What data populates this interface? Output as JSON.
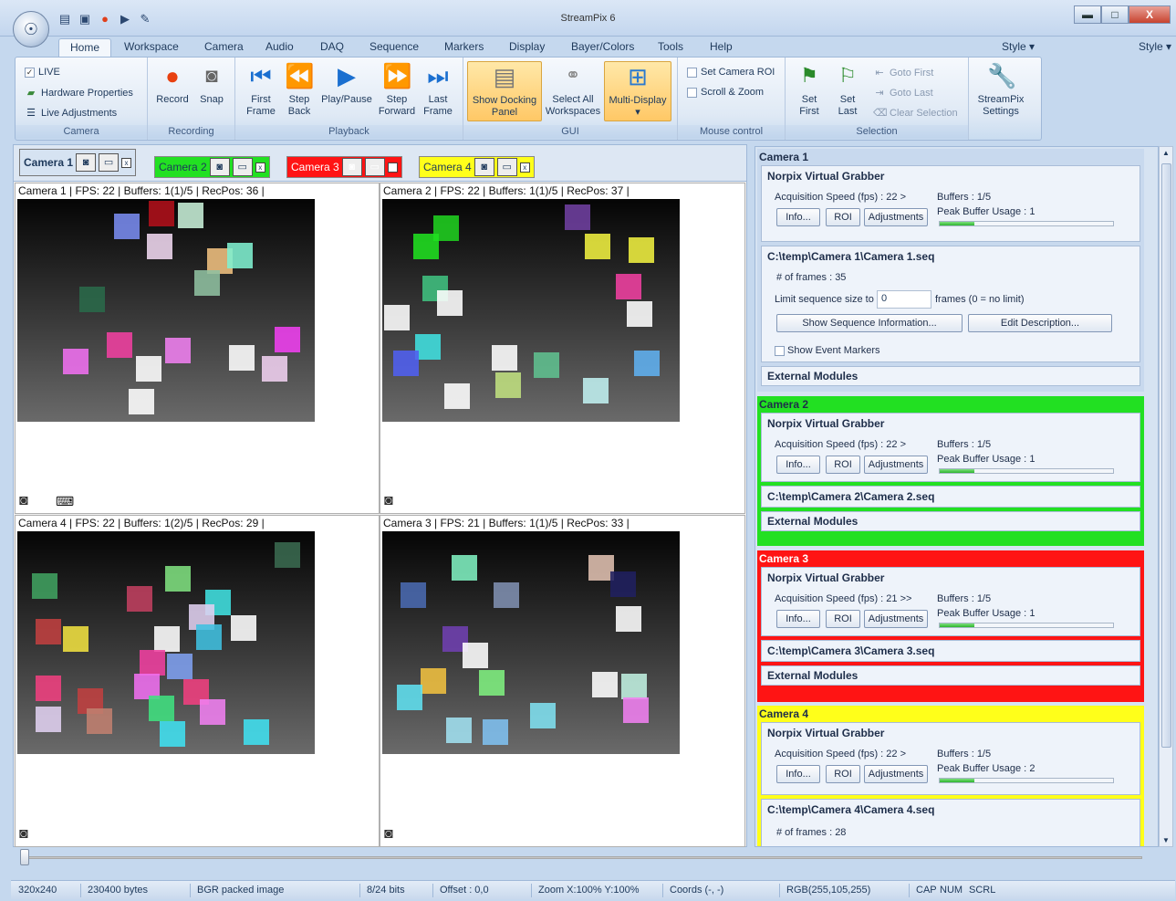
{
  "window": {
    "title": "StreamPix 6",
    "minimize": "▬",
    "maximize": "□",
    "close": "X"
  },
  "ribbon": {
    "tabs": [
      "Home",
      "Workspace",
      "Camera",
      "Audio",
      "DAQ",
      "Sequence",
      "Markers",
      "Display",
      "Bayer/Colors",
      "Tools",
      "Help"
    ],
    "style_label": "Style",
    "camera_group": {
      "label": "Camera",
      "live": "LIVE",
      "hardware": "Hardware Properties",
      "adjust": "Live Adjustments"
    },
    "recording_group": {
      "label": "Recording",
      "record": "Record",
      "snap": "Snap"
    },
    "playback_group": {
      "label": "Playback",
      "first": "First Frame",
      "step_back": "Step Back",
      "play": "Play/Pause",
      "step_fwd": "Step Forward",
      "last": "Last Frame"
    },
    "gui_group": {
      "label": "GUI",
      "show_dock": "Show Docking Panel",
      "select_all": "Select All Workspaces",
      "multi": "Multi-Display"
    },
    "mouse_group": {
      "label": "Mouse control",
      "roi": "Set Camera ROI",
      "scroll": "Scroll & Zoom"
    },
    "selection_group": {
      "label": "Selection",
      "set_first": "Set First",
      "set_last": "Set Last",
      "goto_first": "Goto First",
      "goto_last": "Goto Last",
      "clear": "Clear Selection"
    },
    "settings": {
      "label": "StreamPix Settings"
    }
  },
  "camera_tabs": [
    {
      "label": "Camera 1",
      "color": "#d6e3f2"
    },
    {
      "label": "Camera 2",
      "color": "#22e022"
    },
    {
      "label": "Camera 3",
      "color": "#ff1414"
    },
    {
      "label": "Camera 4",
      "color": "#ffff1a"
    }
  ],
  "panes": {
    "cam1": "Camera 1 | FPS: 22 | Buffers: 1(1)/5 | RecPos: 36 |",
    "cam2": "Camera 2 | FPS: 22 | Buffers: 1(1)/5 | RecPos: 37 |",
    "cam4": "Camera 4 | FPS: 22 | Buffers: 1(2)/5 | RecPos: 29 |",
    "cam3": "Camera 3 | FPS: 21 | Buffers: 1(1)/5 | RecPos: 33 |"
  },
  "side": {
    "grabber": "Norpix Virtual Grabber",
    "info": "Info...",
    "roi": "ROI",
    "adjust": "Adjustments",
    "peak": "Peak Buffer Usage :",
    "ext": "External Modules",
    "cameras": [
      {
        "name": "Camera 1",
        "color": "#d6e3f2",
        "acq": "Acquisition Speed (fps) : 22 >",
        "buffers": "Buffers : 1/5",
        "peak_val": "1",
        "usage": 0.2,
        "seq": "C:\\temp\\Camera 1\\Camera 1.seq"
      },
      {
        "name": "Camera 2",
        "color": "#22e022",
        "acq": "Acquisition Speed (fps) : 22 >",
        "buffers": "Buffers : 1/5",
        "peak_val": "1",
        "usage": 0.2,
        "seq": "C:\\temp\\Camera 2\\Camera 2.seq"
      },
      {
        "name": "Camera 3",
        "color": "#ff1414",
        "acq": "Acquisition Speed (fps) : 21 >>",
        "buffers": "Buffers : 1/5",
        "peak_val": "1",
        "usage": 0.2,
        "seq": "C:\\temp\\Camera 3\\Camera 3.seq"
      },
      {
        "name": "Camera 4",
        "color": "#ffff1a",
        "acq": "Acquisition Speed (fps) : 22 >",
        "buffers": "Buffers : 1/5",
        "peak_val": "2",
        "usage": 0.2,
        "seq": "C:\\temp\\Camera 4\\Camera 4.seq"
      }
    ],
    "seq1": {
      "frames": "# of frames : 35",
      "limit_label": "Limit sequence size to",
      "limit_value": "0",
      "limit_suffix": "frames (0 = no limit)",
      "show_info": "Show Sequence Information...",
      "edit_desc": "Edit Description...",
      "markers": "Show Event Markers"
    },
    "seq4": {
      "frames": "# of frames : 28"
    }
  },
  "status": [
    "320x240",
    "230400 bytes",
    "BGR packed image",
    "8/24 bits",
    "Offset : 0,0",
    "Zoom X:100%  Y:100%",
    "Coords (-, -)",
    "RGB(255,105,255)",
    "CAP",
    "NUM",
    "SCRL"
  ]
}
